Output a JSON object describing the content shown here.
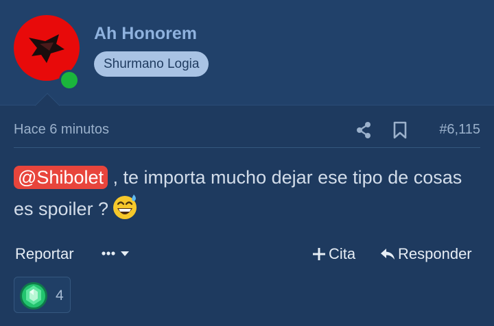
{
  "user": {
    "name": "Ah Honorem",
    "title": "Shurmano Logia",
    "online": true
  },
  "post": {
    "time": "Hace 6 minutos",
    "number": "#6,115",
    "mention": "@Shibolet",
    "text": " , te importa mucho dejar ese tipo de cosas es spoiler ?",
    "emoji": "grinning-face-with-sweat"
  },
  "actions": {
    "report": "Reportar",
    "quote": "Cita",
    "reply": "Responder"
  },
  "reaction": {
    "icon": "green-gem-icon",
    "count": "4"
  },
  "colors": {
    "background": "#1e3a5f",
    "header": "#21416a",
    "mention": "#e8453c",
    "online": "#1bb53c"
  }
}
